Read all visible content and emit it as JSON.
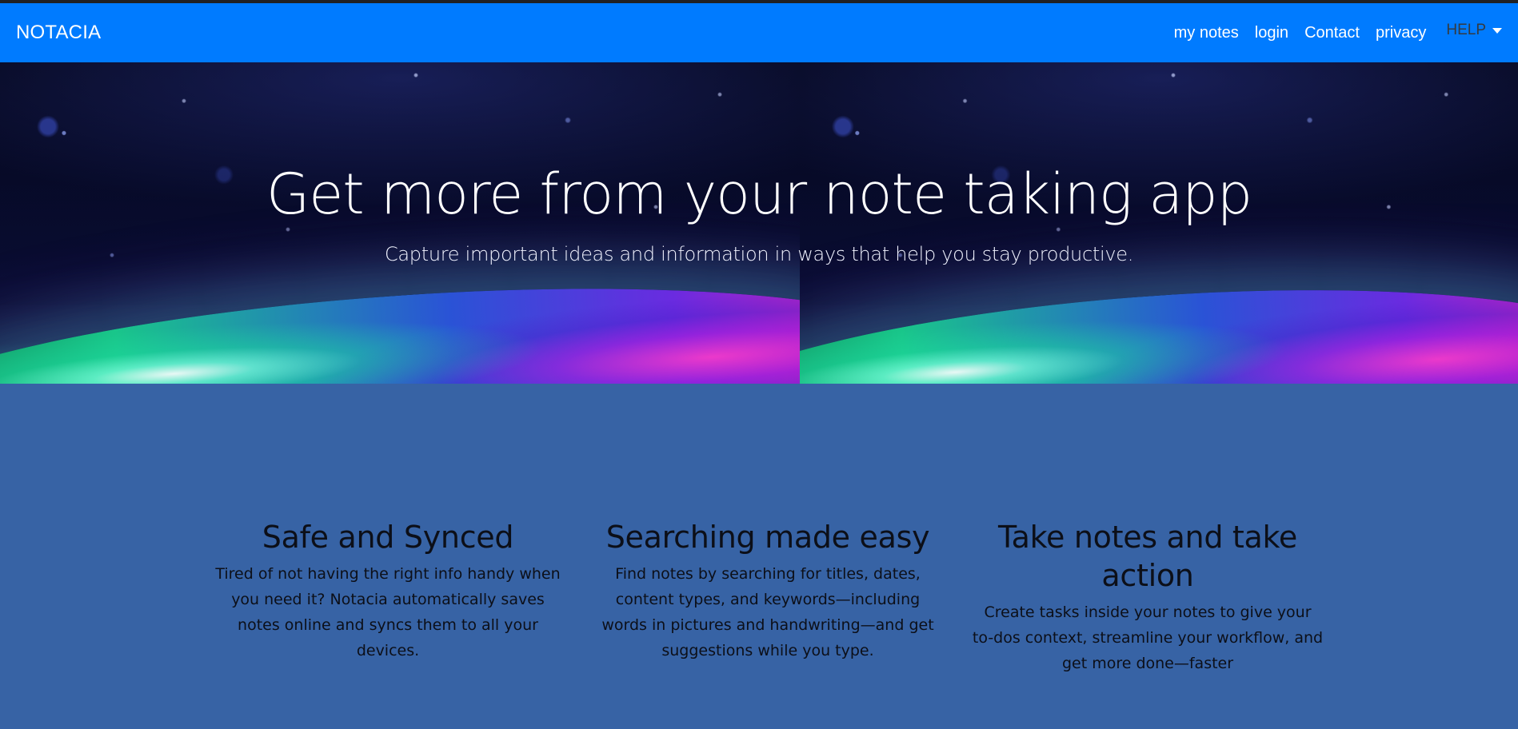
{
  "navbar": {
    "brand": "NOTACIA",
    "links": [
      {
        "label": "my notes"
      },
      {
        "label": "login"
      },
      {
        "label": "Contact"
      },
      {
        "label": "privacy"
      }
    ],
    "help": {
      "label": "HELP",
      "icon": "caret-down-icon"
    }
  },
  "hero": {
    "title": "Get more from your note taking app",
    "subtitle": "Capture important ideas and information in ways that help you stay productive."
  },
  "features": [
    {
      "title": "Safe and Synced",
      "text": "Tired of not having the right info handy when you need it? Notacia automatically saves notes online and syncs them to all your devices."
    },
    {
      "title": "Searching made easy",
      "text": "Find notes by searching for titles, dates, content types, and keywords—including words in pictures and handwriting—and get suggestions while you type."
    },
    {
      "title": "Take notes and take action",
      "text": "Create tasks inside your notes to give your to-dos context, streamline your workflow, and get more done—faster"
    }
  ],
  "colors": {
    "navbar": "#007bff",
    "page_background": "#3763a5",
    "hero_background": "#02030d"
  }
}
